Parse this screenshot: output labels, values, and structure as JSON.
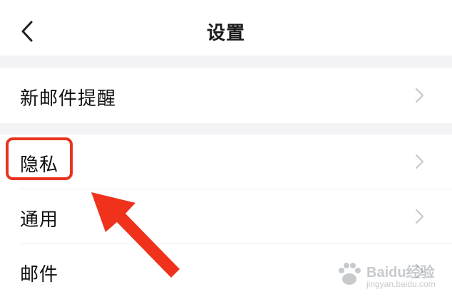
{
  "header": {
    "title": "设置",
    "back_icon": "chevron-left-icon"
  },
  "settings": {
    "items": [
      {
        "label": "新邮件提醒",
        "icon": "chevron-right-icon"
      },
      {
        "label": "隐私",
        "icon": "chevron-right-icon"
      },
      {
        "label": "通用",
        "icon": "chevron-right-icon"
      },
      {
        "label": "邮件",
        "icon": "chevron-right-icon"
      }
    ]
  },
  "annotation": {
    "highlight_color": "#e8331f",
    "highlighted_item": "隐私"
  },
  "watermark": {
    "brand": "Baidu经验",
    "sub": "jingyan.baidu.com"
  },
  "colors": {
    "background": "#ffffff",
    "separator": "#f3f3f5",
    "text": "#111111",
    "chevron": "#c7c7cc"
  }
}
